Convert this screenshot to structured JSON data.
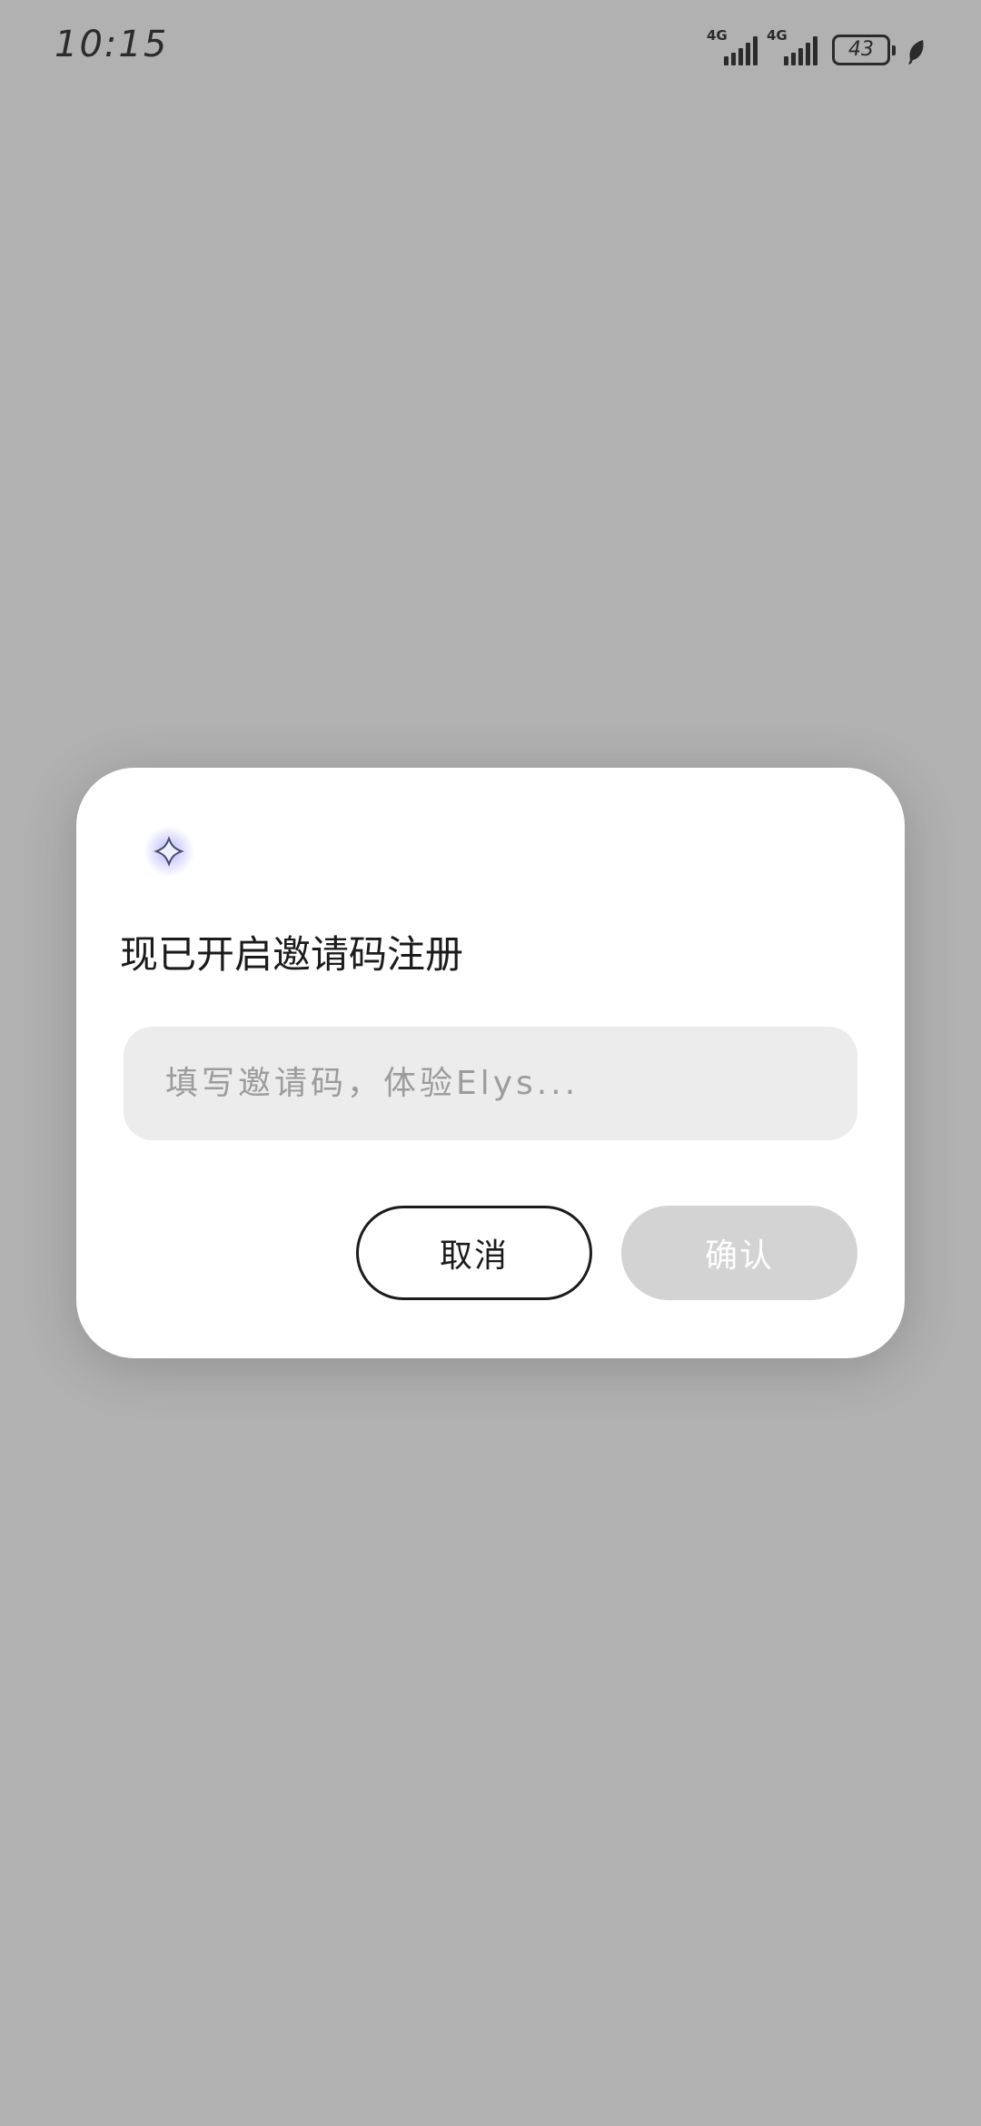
{
  "status_bar": {
    "time": "10:15",
    "signal_1": "4G",
    "signal_2": "4G",
    "battery": "43",
    "icons": [
      "signal-4g-icon",
      "signal-4g-icon",
      "battery-icon",
      "leaf-power-saving-icon"
    ]
  },
  "dialog": {
    "logo_icon": "sparkle-logo-icon",
    "title": "现已开启邀请码注册",
    "input_placeholder": "填写邀请码，体验Elys...",
    "input_value": "",
    "cancel_label": "取消",
    "confirm_label": "确认"
  },
  "colors": {
    "backdrop": "#b1b1b1",
    "dialog_bg": "#ffffff",
    "input_bg": "#ececec",
    "confirm_disabled_bg": "#d3d3d3",
    "text_primary": "#1b1b1b",
    "placeholder": "#9c9c9c",
    "logo_accent": "#6b6bff"
  }
}
